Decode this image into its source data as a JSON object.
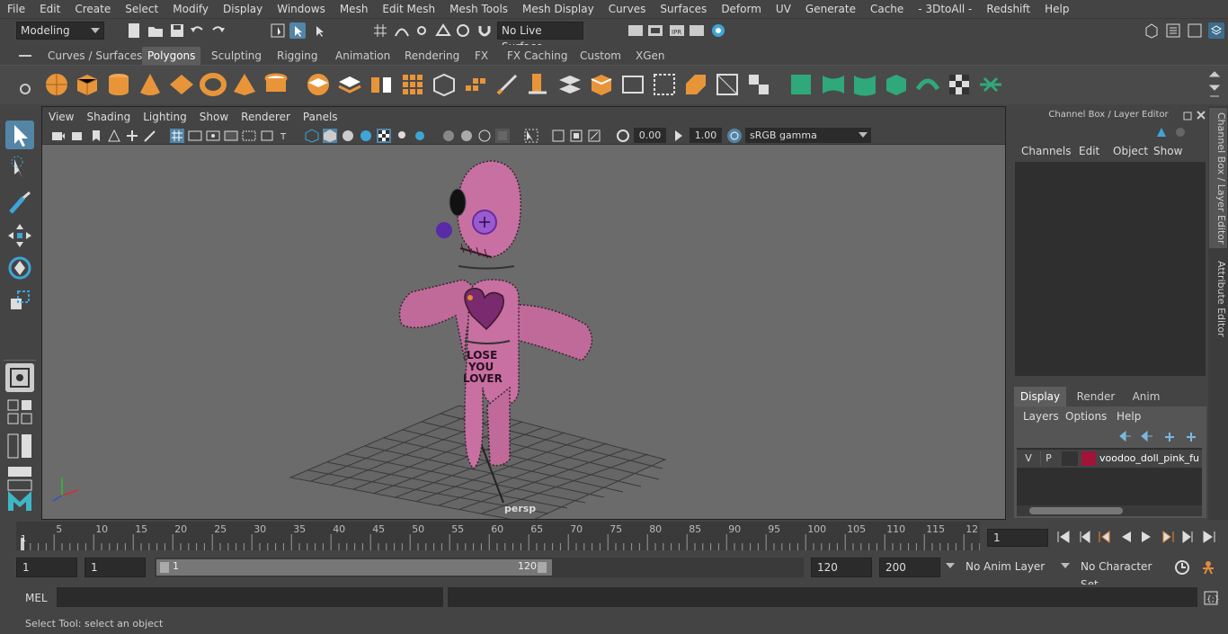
{
  "menubar": {
    "items": [
      "File",
      "Edit",
      "Create",
      "Select",
      "Modify",
      "Display",
      "Windows",
      "Mesh",
      "Edit Mesh",
      "Mesh Tools",
      "Mesh Display",
      "Curves",
      "Surfaces",
      "Deform",
      "UV",
      "Generate",
      "Cache",
      "- 3DtoAll -",
      "Redshift",
      "Help"
    ]
  },
  "statusline": {
    "workspace": "Modeling",
    "live_surface": "No Live Surface"
  },
  "shelf": {
    "tabs": [
      "Curves / Surfaces",
      "Polygons",
      "Sculpting",
      "Rigging",
      "Animation",
      "Rendering",
      "FX",
      "FX Caching",
      "Custom",
      "XGen"
    ],
    "active_tab": "Polygons"
  },
  "viewport": {
    "menu": [
      "View",
      "Shading",
      "Lighting",
      "Show",
      "Renderer",
      "Panels"
    ],
    "exposure": "0.00",
    "gamma": "1.00",
    "colorspace": "sRGB gamma",
    "camera_label": "persp",
    "doll_text": [
      "LOSE",
      "YOU",
      "LOVER"
    ]
  },
  "channelbox": {
    "title": "Channel Box / Layer Editor",
    "menu": [
      "Channels",
      "Edit",
      "Object",
      "Show"
    ],
    "layer_tabs": [
      "Display",
      "Render",
      "Anim"
    ],
    "active_layer_tab": "Display",
    "layer_menu": [
      "Layers",
      "Options",
      "Help"
    ],
    "layers": [
      {
        "v": "V",
        "p": "P",
        "color": "#a0143a",
        "name": "voodoo_doll_pink_fur"
      }
    ]
  },
  "sidetabs": [
    "Channel Box / Layer Editor",
    "Attribute Editor"
  ],
  "timeline": {
    "ticks": [
      "5",
      "10",
      "15",
      "20",
      "25",
      "30",
      "35",
      "40",
      "45",
      "50",
      "55",
      "60",
      "65",
      "70",
      "75",
      "80",
      "85",
      "90",
      "95",
      "100",
      "105",
      "110",
      "115",
      "12"
    ],
    "start_marker": "1",
    "current_frame": "1"
  },
  "range": {
    "start": "1",
    "anim_start": "1",
    "slider_start": "1",
    "slider_end": "120",
    "end": "120",
    "anim_end": "200",
    "anim_layer": "No Anim Layer",
    "character_set": "No Character Set"
  },
  "cmdline": {
    "label": "MEL"
  },
  "helpline": {
    "text": "Select Tool: select an object"
  }
}
